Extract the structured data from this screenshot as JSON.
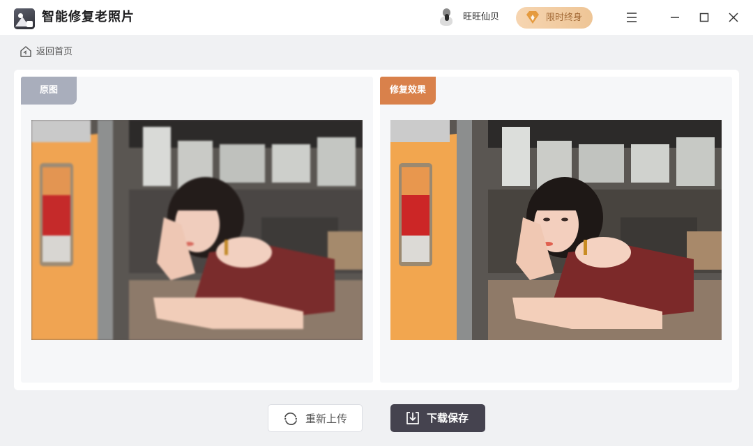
{
  "app": {
    "title": "智能修复老照片",
    "logo_icon": "photo-repair-logo-icon"
  },
  "user": {
    "name": "旺旺仙贝",
    "avatar_icon": "user-avatar-icon"
  },
  "vip": {
    "label": "限时终身",
    "icon": "vip-diamond-icon",
    "color": "#a36a36"
  },
  "window_controls": {
    "menu_icon": "hamburger-menu-icon",
    "minimize_icon": "minimize-icon",
    "maximize_icon": "maximize-icon",
    "close_icon": "close-icon"
  },
  "breadcrumb": {
    "label": "返回首页",
    "icon": "home-icon"
  },
  "panels": {
    "original": {
      "tag": "原图",
      "tag_color": "#a9aebc"
    },
    "restored": {
      "tag": "修复效果",
      "tag_color": "#d9814b"
    }
  },
  "actions": {
    "reupload": {
      "label": "重新上传",
      "icon": "refresh-icon"
    },
    "download": {
      "label": "下载保存",
      "icon": "download-icon",
      "color": "#45434f"
    }
  }
}
